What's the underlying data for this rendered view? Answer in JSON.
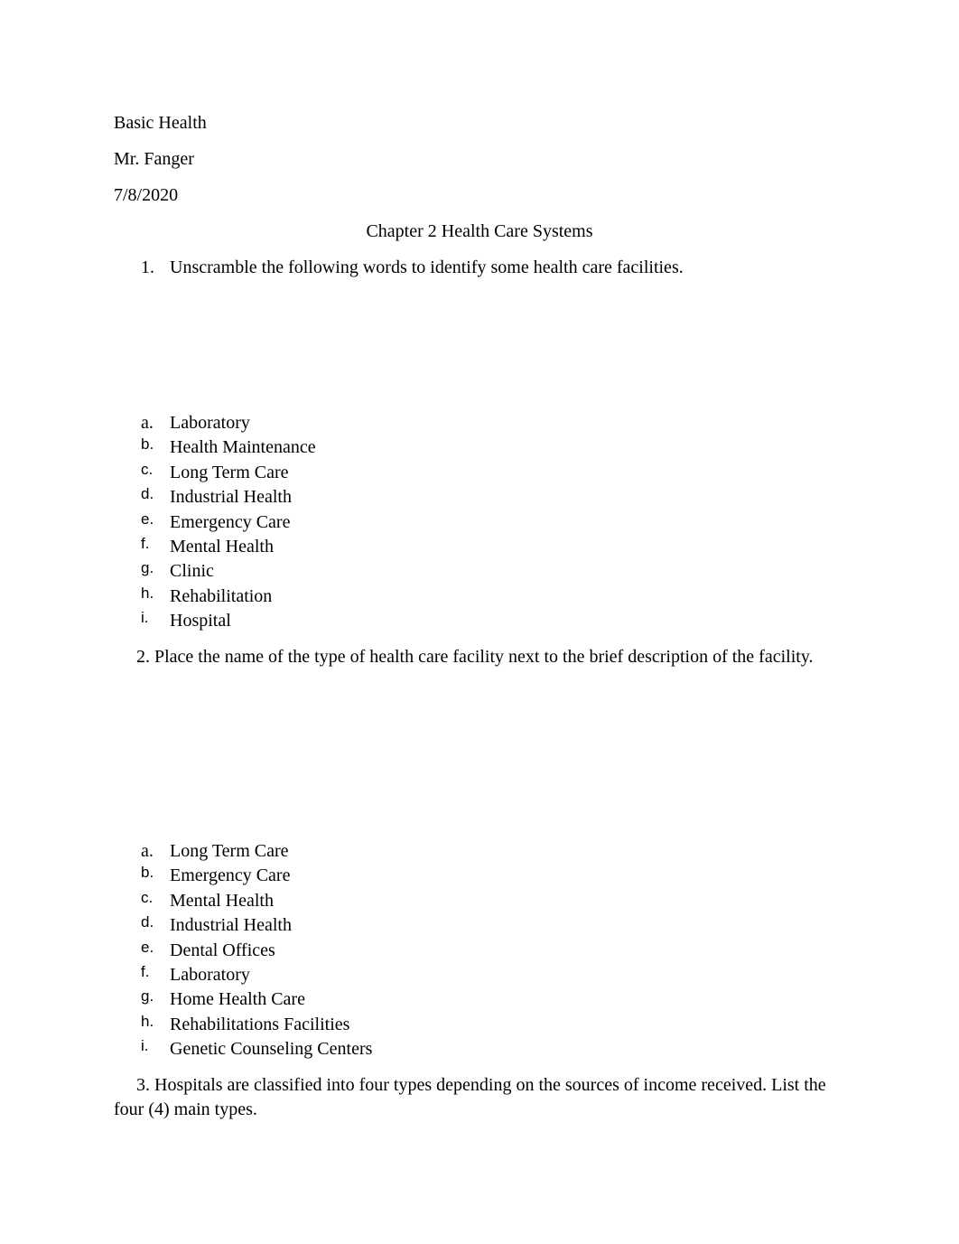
{
  "header": {
    "course": "Basic Health",
    "teacher": "Mr. Fanger",
    "date": "7/8/2020"
  },
  "title": "Chapter 2 Health Care Systems",
  "question1": {
    "number": "1.",
    "text": "Unscramble the following words to identify some health care facilities.",
    "answers": [
      {
        "marker": "a.",
        "text": "Laboratory"
      },
      {
        "marker": "b.",
        "text": "Health Maintenance"
      },
      {
        "marker": "c.",
        "text": "Long Term Care"
      },
      {
        "marker": "d.",
        "text": "Industrial Health"
      },
      {
        "marker": "e.",
        "text": "Emergency Care"
      },
      {
        "marker": "f.",
        "text": "Mental Health"
      },
      {
        "marker": "g.",
        "text": "Clinic"
      },
      {
        "marker": "h.",
        "text": "Rehabilitation"
      },
      {
        "marker": "i.",
        "text": "Hospital"
      }
    ]
  },
  "question2": {
    "text": "2. Place the name of the type of health care facility next to the brief description of the facility.",
    "answers": [
      {
        "marker": "a.",
        "text": "Long Term Care"
      },
      {
        "marker": "b.",
        "text": "Emergency Care"
      },
      {
        "marker": "c.",
        "text": "Mental Health"
      },
      {
        "marker": "d.",
        "text": "Industrial Health"
      },
      {
        "marker": "e.",
        "text": "Dental Offices"
      },
      {
        "marker": "f.",
        "text": "Laboratory"
      },
      {
        "marker": "g.",
        "text": "Home Health Care"
      },
      {
        "marker": "h.",
        "text": "Rehabilitations Facilities"
      },
      {
        "marker": "i.",
        "text": "Genetic Counseling Centers"
      }
    ]
  },
  "question3": {
    "text": "3. Hospitals are classified into four types depending on the sources of income received. List the four (4) main types."
  }
}
